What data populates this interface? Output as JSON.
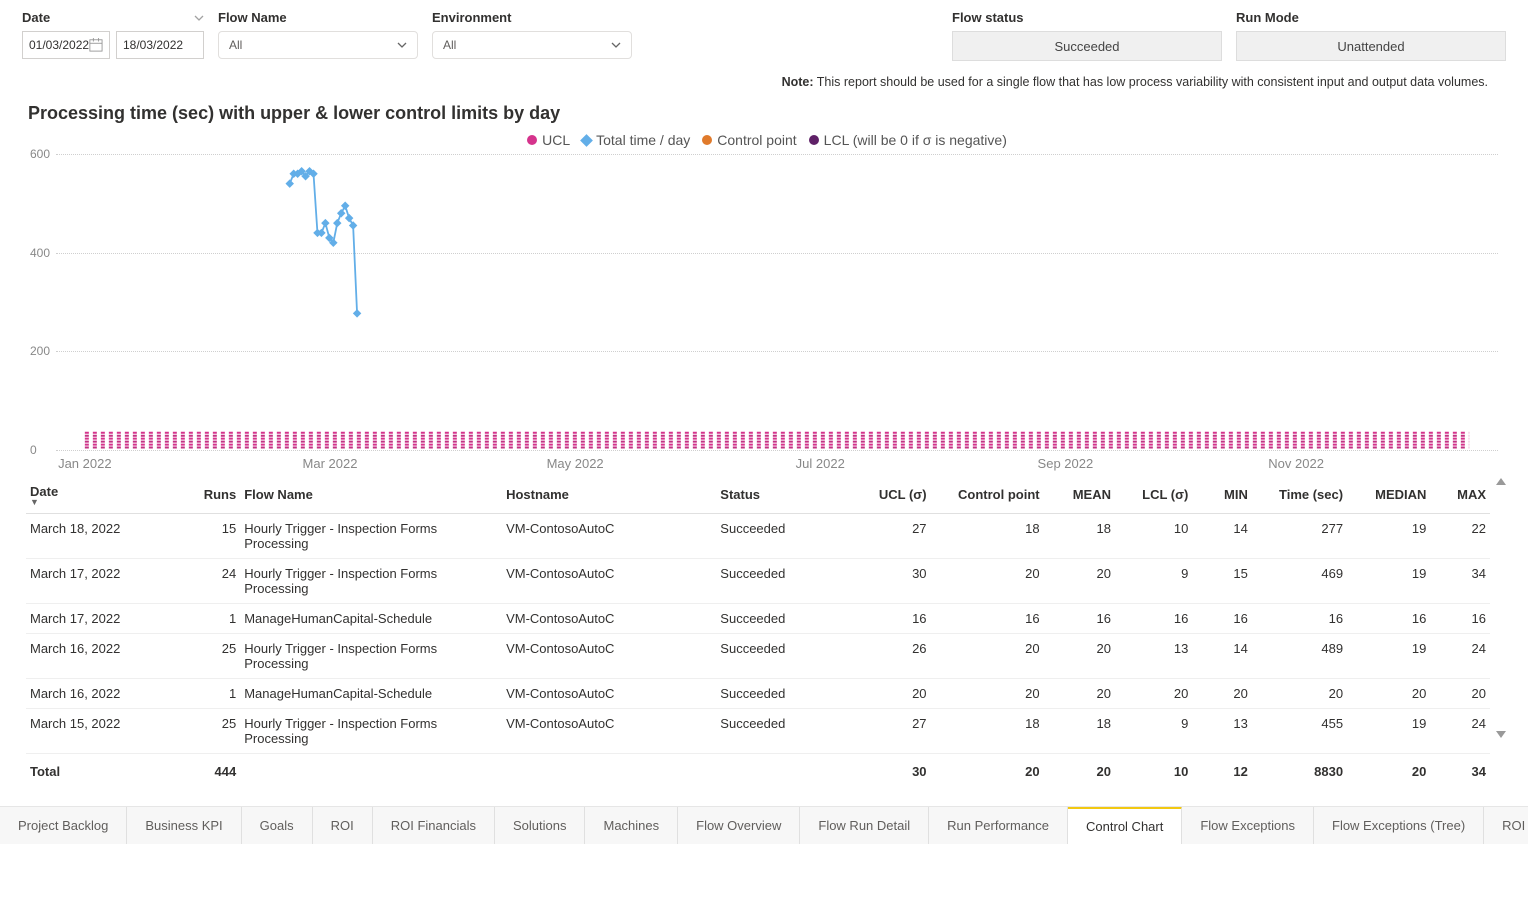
{
  "filters": {
    "date": {
      "label": "Date",
      "from": "01/03/2022",
      "to": "18/03/2022"
    },
    "flow_name": {
      "label": "Flow Name",
      "value": "All"
    },
    "environment": {
      "label": "Environment",
      "value": "All"
    },
    "flow_status": {
      "label": "Flow status",
      "value": "Succeeded"
    },
    "run_mode": {
      "label": "Run Mode",
      "value": "Unattended"
    }
  },
  "note": {
    "bold": "Note:",
    "text": "This report should be used for a single flow that has low process variability with consistent input and output data volumes."
  },
  "chart": {
    "title": "Processing time (sec) with upper & lower control limits by day",
    "legend": {
      "ucl": "UCL",
      "total": "Total time / day",
      "cp": "Control point",
      "lcl": "LCL (will be 0 if σ is negative)"
    },
    "yticks": [
      "0",
      "200",
      "400",
      "600"
    ],
    "xticks": [
      "Jan 2022",
      "Mar 2022",
      "May 2022",
      "Jul 2022",
      "Sep 2022",
      "Nov 2022"
    ]
  },
  "chart_data": {
    "type": "line",
    "title": "Processing time (sec) with upper & lower control limits by day",
    "xlabel": "",
    "ylabel": "",
    "ylim": [
      0,
      600
    ],
    "x_axis_range": [
      "2022-01-01",
      "2022-12-31"
    ],
    "x_ticks": [
      "Jan 2022",
      "Mar 2022",
      "May 2022",
      "Jul 2022",
      "Sep 2022",
      "Nov 2022"
    ],
    "series": [
      {
        "name": "UCL",
        "color": "#d5338c",
        "x": [],
        "y": [],
        "note": "torn/stacked band at y≈0–30 across entire x range"
      },
      {
        "name": "Total time / day",
        "color": "#62aee8",
        "x": [
          "2022-03-01",
          "2022-03-02",
          "2022-03-03",
          "2022-03-04",
          "2022-03-05",
          "2022-03-06",
          "2022-03-07",
          "2022-03-08",
          "2022-03-09",
          "2022-03-10",
          "2022-03-11",
          "2022-03-12",
          "2022-03-13",
          "2022-03-14",
          "2022-03-15",
          "2022-03-16",
          "2022-03-17",
          "2022-03-18"
        ],
        "y": [
          540,
          560,
          560,
          565,
          555,
          565,
          560,
          440,
          440,
          460,
          430,
          420,
          460,
          480,
          495,
          470,
          455,
          277
        ]
      },
      {
        "name": "Control point",
        "color": "#e07a2b",
        "x": [],
        "y": []
      },
      {
        "name": "LCL (will be 0 if σ is negative)",
        "color": "#5f2167",
        "x": [],
        "y": []
      }
    ]
  },
  "table": {
    "headers": {
      "date": "Date",
      "runs": "Runs",
      "flow": "Flow Name",
      "host": "Hostname",
      "status": "Status",
      "ucl": "UCL (σ)",
      "cp": "Control point",
      "mean": "MEAN",
      "lcl": "LCL (σ)",
      "min": "MIN",
      "time": "Time (sec)",
      "median": "MEDIAN",
      "max": "MAX"
    },
    "rows": [
      {
        "date": "March 18, 2022",
        "runs": "15",
        "flow": "Hourly Trigger - Inspection Forms Processing",
        "host": "VM-ContosoAutoC",
        "status": "Succeeded",
        "ucl": "27",
        "cp": "18",
        "mean": "18",
        "lcl": "10",
        "min": "14",
        "time": "277",
        "median": "19",
        "max": "22"
      },
      {
        "date": "March 17, 2022",
        "runs": "24",
        "flow": "Hourly Trigger - Inspection Forms Processing",
        "host": "VM-ContosoAutoC",
        "status": "Succeeded",
        "ucl": "30",
        "cp": "20",
        "mean": "20",
        "lcl": "9",
        "min": "15",
        "time": "469",
        "median": "19",
        "max": "34"
      },
      {
        "date": "March 17, 2022",
        "runs": "1",
        "flow": "ManageHumanCapital-Schedule",
        "host": "VM-ContosoAutoC",
        "status": "Succeeded",
        "ucl": "16",
        "cp": "16",
        "mean": "16",
        "lcl": "16",
        "min": "16",
        "time": "16",
        "median": "16",
        "max": "16"
      },
      {
        "date": "March 16, 2022",
        "runs": "25",
        "flow": "Hourly Trigger - Inspection Forms Processing",
        "host": "VM-ContosoAutoC",
        "status": "Succeeded",
        "ucl": "26",
        "cp": "20",
        "mean": "20",
        "lcl": "13",
        "min": "14",
        "time": "489",
        "median": "19",
        "max": "24"
      },
      {
        "date": "March 16, 2022",
        "runs": "1",
        "flow": "ManageHumanCapital-Schedule",
        "host": "VM-ContosoAutoC",
        "status": "Succeeded",
        "ucl": "20",
        "cp": "20",
        "mean": "20",
        "lcl": "20",
        "min": "20",
        "time": "20",
        "median": "20",
        "max": "20"
      },
      {
        "date": "March 15, 2022",
        "runs": "25",
        "flow": "Hourly Trigger - Inspection Forms Processing",
        "host": "VM-ContosoAutoC",
        "status": "Succeeded",
        "ucl": "27",
        "cp": "18",
        "mean": "18",
        "lcl": "9",
        "min": "13",
        "time": "455",
        "median": "19",
        "max": "24"
      }
    ],
    "total": {
      "label": "Total",
      "runs": "444",
      "ucl": "30",
      "cp": "20",
      "mean": "20",
      "lcl": "10",
      "min": "12",
      "time": "8830",
      "median": "20",
      "max": "34"
    }
  },
  "tabs": [
    "Project Backlog",
    "Business KPI",
    "Goals",
    "ROI",
    "ROI Financials",
    "Solutions",
    "Machines",
    "Flow Overview",
    "Flow Run Detail",
    "Run Performance",
    "Control Chart",
    "Flow Exceptions",
    "Flow Exceptions (Tree)",
    "ROI Calculations"
  ],
  "active_tab": "Control Chart",
  "colors": {
    "ucl": "#d5338c",
    "total": "#62aee8",
    "cp": "#e07a2b",
    "lcl": "#5f2167"
  }
}
